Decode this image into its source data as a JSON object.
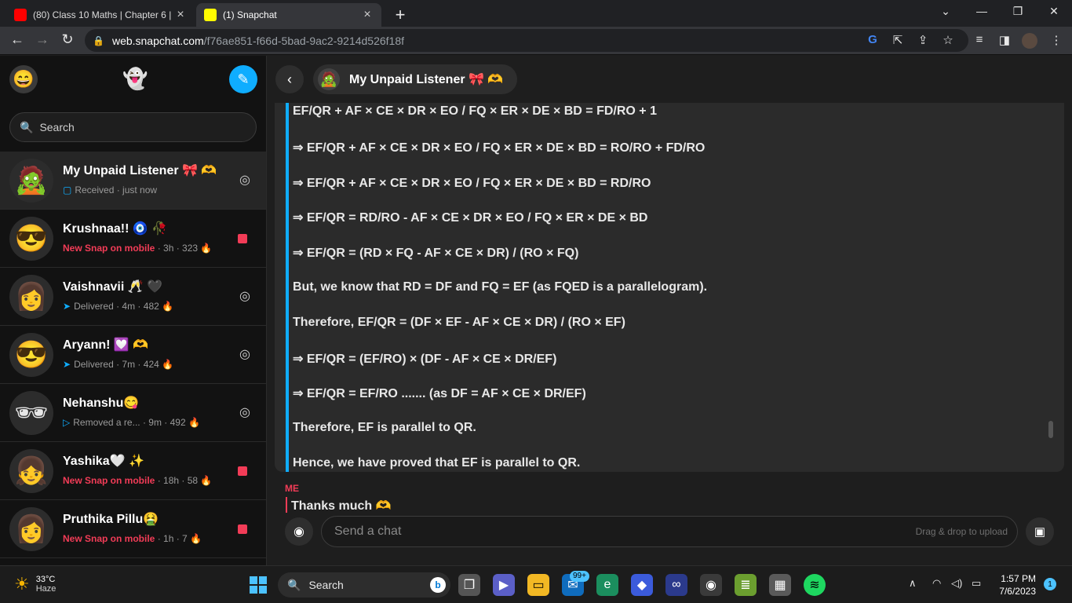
{
  "browser": {
    "tabs": [
      {
        "title": "(80) Class 10 Maths | Chapter 6 | ",
        "favicon_color": "#ff0000"
      },
      {
        "title": "(1) Snapchat",
        "favicon_color": "#fffc00"
      }
    ],
    "new_tab": "+",
    "url_host": "web.snapchat.com",
    "url_path": "/f76ae851-f66d-5bad-9ac2-9214d526f18f"
  },
  "sidebar": {
    "search_placeholder": "Search",
    "chats": [
      {
        "name": "My Unpaid Listener 🎀 🫶",
        "status": "Received",
        "meta": " · just now",
        "status_type": "received",
        "action": "camera-icon"
      },
      {
        "name": "Krushnaa!! 🧿 🥀",
        "status": "New Snap on mobile",
        "meta": " · 3h · 323 🔥",
        "status_type": "new",
        "action": "unread-square"
      },
      {
        "name": "Vaishnavii 🥂 🖤",
        "status": "Delivered",
        "meta": " · 4m · 482 🔥",
        "status_type": "delivered",
        "action": "camera-icon"
      },
      {
        "name": "Aryann! 💟 🫶",
        "status": "Delivered",
        "meta": " · 7m · 424 🔥",
        "status_type": "delivered",
        "action": "camera-icon"
      },
      {
        "name": "Nehanshu😋",
        "status": "Removed a re...",
        "meta": " · 9m · 492 🔥",
        "status_type": "removed",
        "action": "camera-icon"
      },
      {
        "name": "Yashika🤍 ✨",
        "status": "New Snap on mobile",
        "meta": " · 18h · 58 🔥",
        "status_type": "new",
        "action": "unread-square"
      },
      {
        "name": "Pruthika Pillu🤮",
        "status": "New Snap on mobile",
        "meta": " · 1h · 7 🔥",
        "status_type": "new",
        "action": "unread-square"
      }
    ]
  },
  "conversation": {
    "title": "My Unpaid Listener 🎀 🫶",
    "message_lines": [
      "EF/QR + AF × CE × DR × EO / FQ × ER × DE × BD = FD/RO + 1",
      "⇒ EF/QR + AF × CE × DR × EO / FQ × ER × DE × BD = RO/RO + FD/RO",
      "⇒ EF/QR + AF × CE × DR × EO / FQ × ER × DE × BD = RD/RO",
      "⇒ EF/QR = RD/RO - AF × CE × DR × EO / FQ × ER × DE × BD",
      "⇒ EF/QR = (RD × FQ - AF × CE × DR) / (RO × FQ)",
      "But, we know that RD = DF and FQ = EF (as FQED is a parallelogram).",
      "Therefore, EF/QR = (DF × EF - AF × CE × DR) / (RO × EF)",
      "⇒ EF/QR = (EF/RO) × (DF - AF × CE × DR/EF)",
      "⇒ EF/QR = EF/RO ....... (as DF = AF × CE × DR/EF)",
      "Therefore, EF is parallel to QR.",
      "Hence, we have proved that EF is parallel to QR."
    ],
    "me_label": "ME",
    "me_message": "Thanks much 🫶",
    "composer_placeholder": "Send a chat",
    "drag_drop": "Drag & drop to upload"
  },
  "taskbar": {
    "temperature": "33°C",
    "condition": "Haze",
    "search_label": "Search",
    "mail_badge": "99+",
    "time": "1:57 PM",
    "date": "7/6/2023",
    "notifications": "1"
  },
  "colors": {
    "accent_blue": "#0fadff",
    "snap_red": "#f23c57"
  }
}
